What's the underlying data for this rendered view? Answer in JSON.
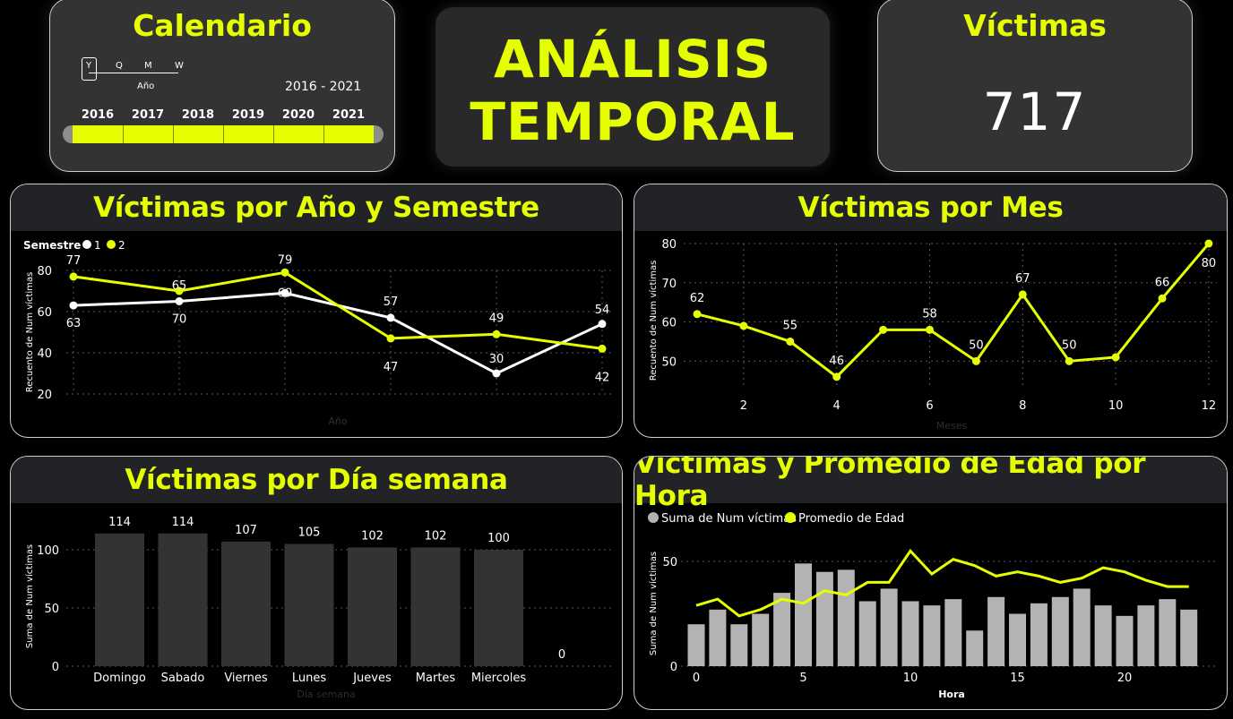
{
  "calendar": {
    "title": "Calendario",
    "granularity": [
      "Y",
      "Q",
      "M",
      "W"
    ],
    "granularity_label": "Año",
    "range": "2016 - 2021",
    "years": [
      "2016",
      "2017",
      "2018",
      "2019",
      "2020",
      "2021"
    ]
  },
  "header": {
    "line1": "ANÁLISIS",
    "line2": "TEMPORAL"
  },
  "victims_card": {
    "title": "Víctimas",
    "value": "717"
  },
  "panels": {
    "year_semester": "Víctimas por Año y Semestre",
    "month": "Víctimas por Mes",
    "weekday": "Víctimas por Día semana",
    "hour": "Víctimas y Promedio de Edad por Hora"
  },
  "colors": {
    "accent": "#e6ff00",
    "white": "#ffffff",
    "bar_dark": "#333333",
    "bar_light": "#b3b3b3",
    "card": "#333333"
  },
  "chart_data": [
    {
      "id": "year_semester",
      "type": "line",
      "title": "Víctimas por Año y Semestre",
      "legend_title": "Semestre",
      "xlabel": "Año",
      "ylabel": "Recuento de Num víctimas",
      "categories": [
        "2016",
        "2017",
        "2018",
        "2019",
        "2020",
        "2021"
      ],
      "ylim": [
        20,
        80
      ],
      "yticks": [
        20,
        40,
        60,
        80
      ],
      "series": [
        {
          "name": "1",
          "values": [
            63,
            65,
            69,
            57,
            30,
            54
          ],
          "color": "#ffffff"
        },
        {
          "name": "2",
          "values": [
            77,
            70,
            79,
            47,
            49,
            42
          ],
          "color": "#e6ff00"
        }
      ],
      "data_labels_series1": [
        "63",
        "70",
        "69",
        "57",
        "30",
        "54"
      ],
      "data_labels_series2": [
        "77",
        "65",
        "79",
        "47",
        "49",
        "42"
      ]
    },
    {
      "id": "month",
      "type": "line",
      "title": "Víctimas por Mes",
      "xlabel": "Meses",
      "ylabel": "Recuento de Num víctimas",
      "x": [
        1,
        2,
        3,
        4,
        5,
        6,
        7,
        8,
        9,
        10,
        11,
        12
      ],
      "values": [
        62,
        59,
        55,
        46,
        58,
        58,
        50,
        67,
        50,
        51,
        66,
        80
      ],
      "xlim": [
        0.5,
        12
      ],
      "ylim": [
        43,
        80
      ],
      "xticks": [
        2,
        4,
        6,
        8,
        10,
        12
      ],
      "yticks": [
        50,
        60,
        70,
        80
      ],
      "data_labels": [
        {
          "x": 1,
          "text": "62"
        },
        {
          "x": 3,
          "text": "55"
        },
        {
          "x": 4,
          "text": "46"
        },
        {
          "x": 6,
          "text": "58"
        },
        {
          "x": 7,
          "text": "50"
        },
        {
          "x": 8,
          "text": "67"
        },
        {
          "x": 9,
          "text": "50"
        },
        {
          "x": 11,
          "text": "66"
        },
        {
          "x": 12,
          "text": "80"
        }
      ]
    },
    {
      "id": "weekday",
      "type": "bar",
      "title": "Víctimas por Día semana",
      "xlabel": "Día semana",
      "ylabel": "Suma de Num víctimas",
      "categories": [
        "Domingo",
        "Sabado",
        "Viernes",
        "Lunes",
        "Jueves",
        "Martes",
        "Miercoles",
        ""
      ],
      "values": [
        114,
        114,
        107,
        105,
        102,
        102,
        100,
        0
      ],
      "ylim": [
        0,
        120
      ],
      "yticks": [
        0,
        50,
        100
      ]
    },
    {
      "id": "hour",
      "type": "bar",
      "title": "Víctimas y Promedio de Edad por Hora",
      "xlabel": "Hora",
      "ylabel": "Suma de Num víctimas",
      "x": [
        0,
        1,
        2,
        3,
        4,
        5,
        6,
        7,
        8,
        9,
        10,
        11,
        12,
        13,
        14,
        15,
        16,
        17,
        18,
        19,
        20,
        21,
        22,
        23
      ],
      "xticks": [
        0,
        5,
        10,
        15,
        20
      ],
      "ylim": [
        0,
        60
      ],
      "yticks": [
        0,
        50
      ],
      "series": [
        {
          "name": "Suma de Num víctimas",
          "type": "bar",
          "values": [
            20,
            27,
            20,
            25,
            35,
            49,
            45,
            46,
            31,
            37,
            31,
            29,
            32,
            17,
            33,
            25,
            30,
            33,
            37,
            29,
            24,
            29,
            32,
            27
          ]
        },
        {
          "name": "Promedio de Edad",
          "type": "line",
          "values": [
            29,
            32,
            24,
            27,
            32,
            30,
            36,
            34,
            40,
            40,
            55,
            44,
            51,
            48,
            43,
            45,
            43,
            40,
            42,
            47,
            45,
            41,
            38,
            38
          ]
        }
      ]
    }
  ]
}
